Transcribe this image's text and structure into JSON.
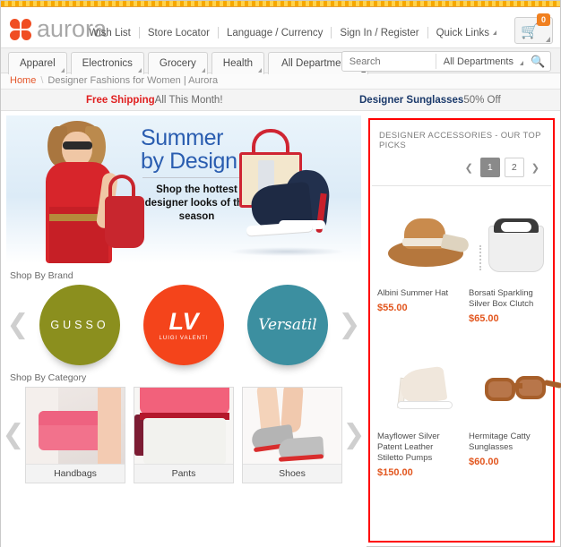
{
  "brand": {
    "name": "aurora",
    "logo_icon": "clover-icon",
    "logo_color": "#f04e23"
  },
  "header": {
    "links": [
      {
        "label": "Wish List",
        "caret": false
      },
      {
        "label": "Store Locator",
        "caret": false
      },
      {
        "label": "Language / Currency",
        "caret": false
      },
      {
        "label": "Sign In / Register",
        "caret": false
      },
      {
        "label": "Quick Links",
        "caret": true
      }
    ],
    "cart": {
      "icon": "shopping-cart-icon",
      "count": "0",
      "badge_color": "#f08020"
    }
  },
  "nav": {
    "tabs": [
      {
        "label": "Apparel"
      },
      {
        "label": "Electronics"
      },
      {
        "label": "Grocery"
      },
      {
        "label": "Health"
      },
      {
        "label": "All Departments"
      }
    ],
    "search": {
      "placeholder": "Search",
      "value": "",
      "department": "All Departments",
      "button_icon": "search-icon"
    }
  },
  "breadcrumb": {
    "home": "Home",
    "separator": "\\",
    "current": "Designer Fashions for Women | Aurora"
  },
  "promo": {
    "left_strong": "Free Shipping",
    "left_rest": " All This Month!",
    "right_strong": "Designer Sunglasses",
    "right_rest": " 50% Off"
  },
  "hero": {
    "title_line1": "Summer",
    "title_line2": "by Design",
    "subtitle": "Shop the hottest designer looks of the season",
    "title_color": "#2a5db0"
  },
  "shop_by_brand": {
    "title": "Shop By Brand",
    "prev_icon": "chevron-left-icon",
    "next_icon": "chevron-right-icon",
    "brands": [
      {
        "name": "GUSSO",
        "sub": "",
        "color": "#8b8f1e"
      },
      {
        "name": "LV",
        "sub": "LUIGI VALENTI",
        "color": "#f4441b"
      },
      {
        "name": "Versatil",
        "sub": "",
        "color": "#3c8fa0"
      }
    ]
  },
  "shop_by_category": {
    "title": "Shop By Category",
    "prev_icon": "chevron-left-icon",
    "next_icon": "chevron-right-icon",
    "categories": [
      {
        "label": "Handbags"
      },
      {
        "label": "Pants"
      },
      {
        "label": "Shoes"
      }
    ]
  },
  "top_picks": {
    "heading": "DESIGNER ACCESSORIES - OUR TOP PICKS",
    "highlight_color": "#ff0000",
    "pager": {
      "prev_icon": "chevron-left-icon",
      "next_icon": "chevron-right-icon",
      "pages": [
        {
          "label": "1",
          "active": true
        },
        {
          "label": "2",
          "active": false
        }
      ]
    },
    "products": [
      {
        "name": "Albini Summer Hat",
        "price": "$55.00",
        "image": "straw-hat-image"
      },
      {
        "name": "Borsati Sparkling Silver Box Clutch",
        "price": "$65.00",
        "image": "silver-clutch-image"
      },
      {
        "name": "Mayflower Silver Patent Leather Stiletto Pumps",
        "price": "$150.00",
        "image": "stiletto-pump-image"
      },
      {
        "name": "Hermitage Catty Sunglasses",
        "price": "$60.00",
        "image": "sunglasses-image"
      }
    ]
  }
}
